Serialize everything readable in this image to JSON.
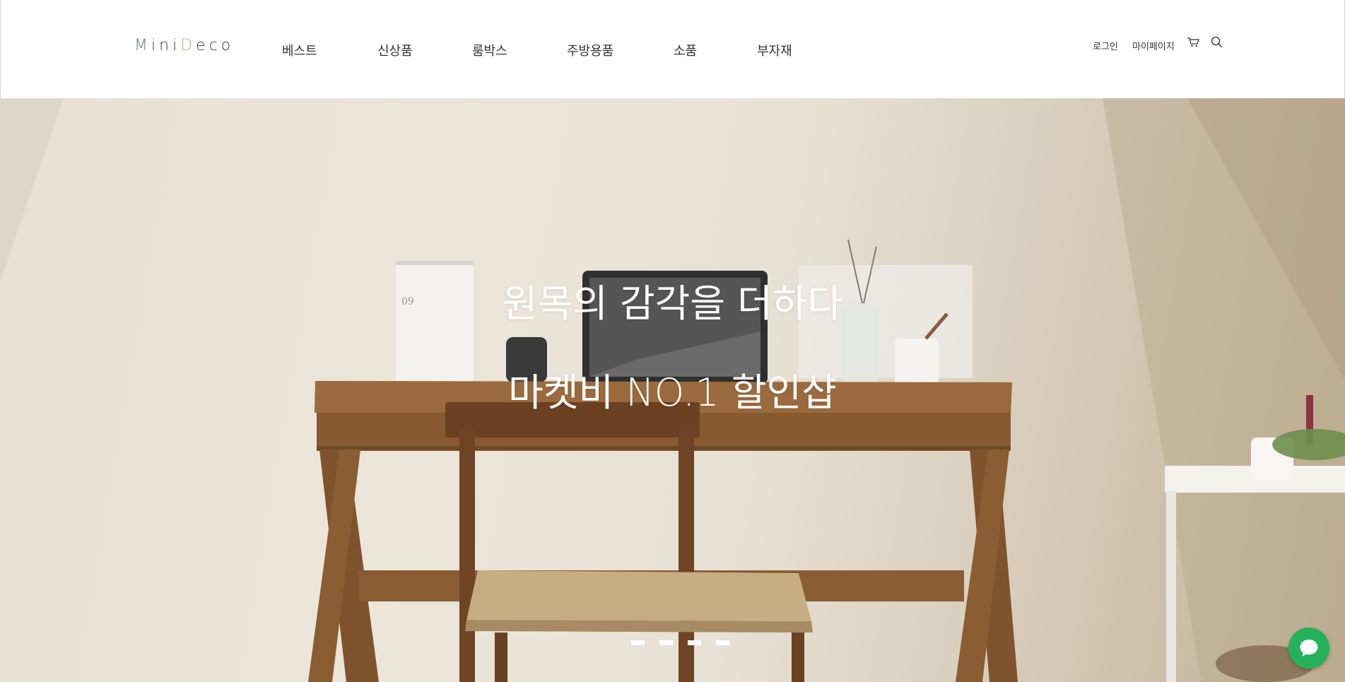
{
  "logo": {
    "text": "MiniDeco",
    "letters": [
      "M",
      "i",
      "n",
      "i",
      "D",
      "e",
      "c",
      "o"
    ]
  },
  "nav": {
    "items": [
      "베스트",
      "신상품",
      "룸박스",
      "주방용품",
      "소품",
      "부자재"
    ]
  },
  "util": {
    "login": "로그인",
    "mypage": "마이페이지",
    "cart_icon": "cart-icon",
    "search_icon": "search-icon"
  },
  "hero": {
    "headline": "원목의 감각을 더하다",
    "subline": "마켓비 NO.1 할인샵",
    "slide_count": 4,
    "active_slide": 1
  },
  "chat": {
    "icon": "chat-bubble-icon"
  },
  "colors": {
    "accent_logo": "#4fa3a8",
    "chat": "#23b15a",
    "text": "#333333"
  }
}
